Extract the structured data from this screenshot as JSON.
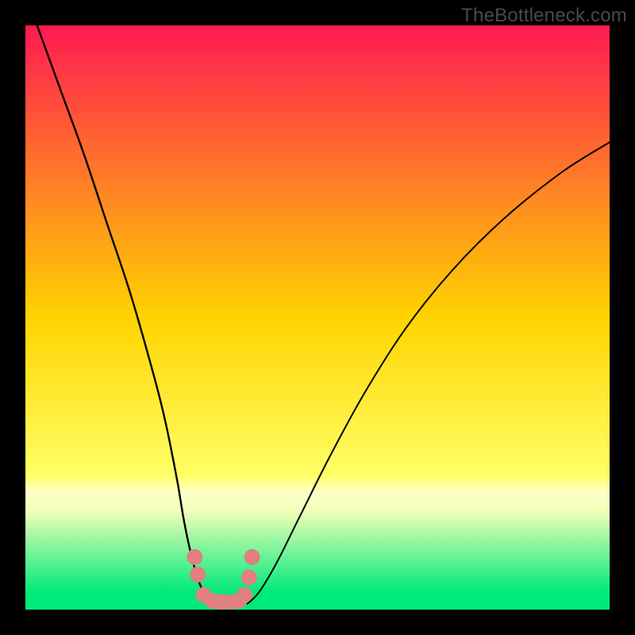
{
  "watermark": "TheBottleneck.com",
  "chart_data": {
    "type": "line",
    "title": "",
    "xlabel": "",
    "ylabel": "",
    "xlim": [
      0,
      100
    ],
    "ylim": [
      0,
      100
    ],
    "grid": false,
    "legend": false,
    "background_gradient": {
      "stops": [
        {
          "offset": 0.0,
          "color": "#ff1a52"
        },
        {
          "offset": 0.5,
          "color": "#ffd400"
        },
        {
          "offset": 0.77,
          "color": "#ffff66"
        },
        {
          "offset": 0.8,
          "color": "#ffffc8"
        },
        {
          "offset": 0.83,
          "color": "#f2ffb8"
        },
        {
          "offset": 0.97,
          "color": "#00e97a"
        },
        {
          "offset": 1.0,
          "color": "#00e97a"
        }
      ]
    },
    "series": [
      {
        "name": "left-branch",
        "type": "curve",
        "x": [
          2,
          6,
          10,
          14,
          18,
          22,
          24,
          26,
          27,
          28,
          29,
          30,
          31,
          32
        ],
        "y": [
          100,
          89,
          78,
          66,
          54,
          40,
          32,
          22,
          16,
          11,
          7,
          4,
          2,
          1
        ]
      },
      {
        "name": "right-branch",
        "type": "curve",
        "x": [
          38,
          40,
          43,
          47,
          52,
          58,
          65,
          73,
          82,
          92,
          100
        ],
        "y": [
          1,
          3,
          8,
          16,
          26,
          37,
          48,
          58,
          67,
          75,
          80
        ]
      },
      {
        "name": "basin-dots",
        "type": "scatter",
        "color": "#e08080",
        "radius": 10,
        "x": [
          29.0,
          29.5,
          30.5,
          32.0,
          33.5,
          35.0,
          36.5,
          37.5,
          38.3,
          38.8
        ],
        "y": [
          9.0,
          6.0,
          2.5,
          1.5,
          1.3,
          1.3,
          1.5,
          2.5,
          5.5,
          9.0
        ]
      }
    ]
  }
}
